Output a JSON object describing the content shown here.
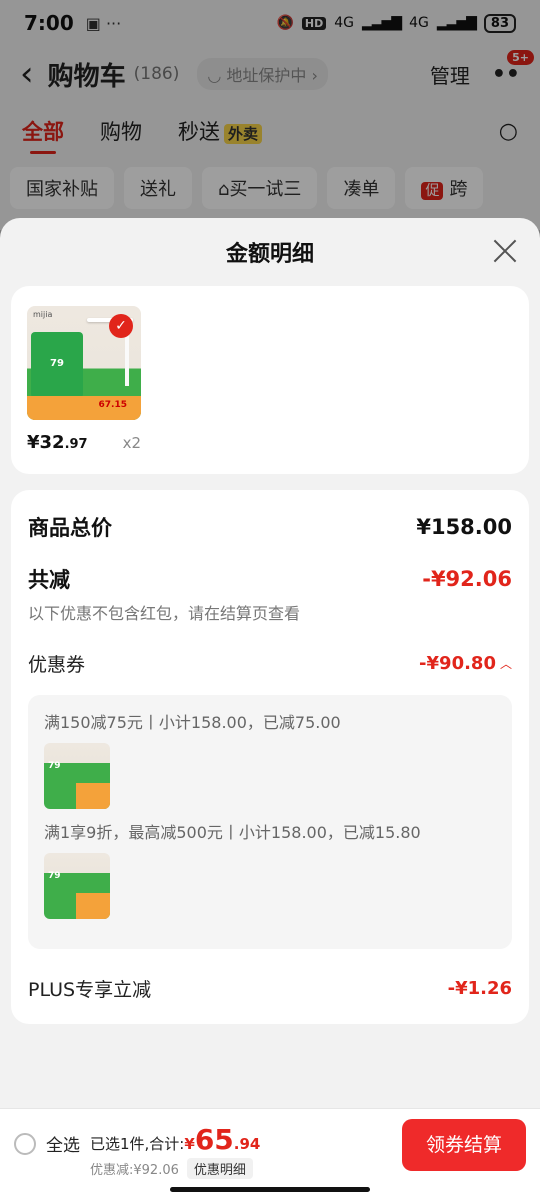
{
  "status_bar": {
    "time": "7:00",
    "hd": "HD",
    "net1": "4G",
    "net2": "4G",
    "battery": "83"
  },
  "nav": {
    "title": "购物车",
    "count": "(186)",
    "addr": "地址保护中",
    "manage": "管理",
    "badge": "5+"
  },
  "tabs": [
    {
      "label": "全部"
    },
    {
      "label": "购物"
    },
    {
      "label": "秒送"
    }
  ],
  "waimai": "外卖",
  "chips": [
    {
      "label": "国家补贴"
    },
    {
      "label": "送礼"
    },
    {
      "label": "买一试三"
    },
    {
      "label": "凑单"
    },
    {
      "label": "跨"
    }
  ],
  "chip_promo": "促",
  "sheet": {
    "title": "金额明细"
  },
  "product": {
    "price_main": "¥32",
    "price_dec": ".97",
    "qty": "x2",
    "thumb_text": "79",
    "thumb_price": "67.15",
    "brand": "mijia"
  },
  "details": {
    "total_label": "商品总价",
    "total_value": "¥158.00",
    "reduce_label": "共减",
    "reduce_value": "-¥92.06",
    "note": "以下优惠不包含红包，请在结算页查看",
    "coupon_label": "优惠券",
    "coupon_value": "-¥90.80",
    "coupon_line1": "满150减75元丨小计158.00，已减75.00",
    "coupon_line2": "满1享9折，最高减500元丨小计158.00，已减15.80",
    "plus_label": "PLUS专享立减",
    "plus_value": "-¥1.26"
  },
  "bottom": {
    "select_all": "全选",
    "selected_text": "已选1件,合计:",
    "currency": "¥",
    "price_int": "65",
    "price_dec": ".94",
    "discount_text": "优惠减:¥92.06",
    "detail_link": "优惠明细",
    "checkout": "领券结算"
  },
  "colors": {
    "accent": "#e1251b",
    "button": "#ef2a2a",
    "sheet_bg": "#f2f2f2"
  }
}
